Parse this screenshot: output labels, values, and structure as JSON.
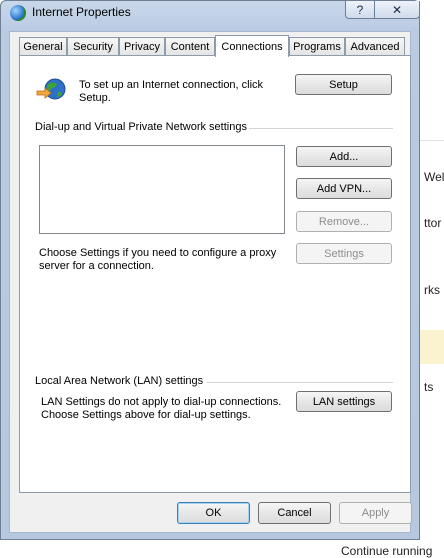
{
  "window": {
    "title": "Internet Properties",
    "help_glyph": "?",
    "close_glyph": "✕"
  },
  "tabs": [
    {
      "label": "General"
    },
    {
      "label": "Security"
    },
    {
      "label": "Privacy"
    },
    {
      "label": "Content"
    },
    {
      "label": "Connections",
      "active": true
    },
    {
      "label": "Programs"
    },
    {
      "label": "Advanced"
    }
  ],
  "setup": {
    "text": "To set up an Internet connection, click Setup.",
    "button": "Setup"
  },
  "dialup": {
    "heading": "Dial-up and Virtual Private Network settings",
    "add_button": "Add...",
    "add_vpn_button": "Add VPN...",
    "remove_button": "Remove...",
    "settings_text": "Choose Settings if you need to configure a proxy server for a connection.",
    "settings_button": "Settings"
  },
  "lan": {
    "heading": "Local Area Network (LAN) settings",
    "text": "LAN Settings do not apply to dial-up connections. Choose Settings above for dial-up settings.",
    "button": "LAN settings"
  },
  "footer": {
    "ok": "OK",
    "cancel": "Cancel",
    "apply": "Apply"
  },
  "background": {
    "fragments": [
      "Wel",
      "ttor",
      "rks",
      "ts"
    ],
    "status": "Continue running"
  },
  "colors": {
    "title_bar": "#c9d7ea",
    "panel": "#ffffff",
    "disabled_text": "#8d8d8d"
  }
}
